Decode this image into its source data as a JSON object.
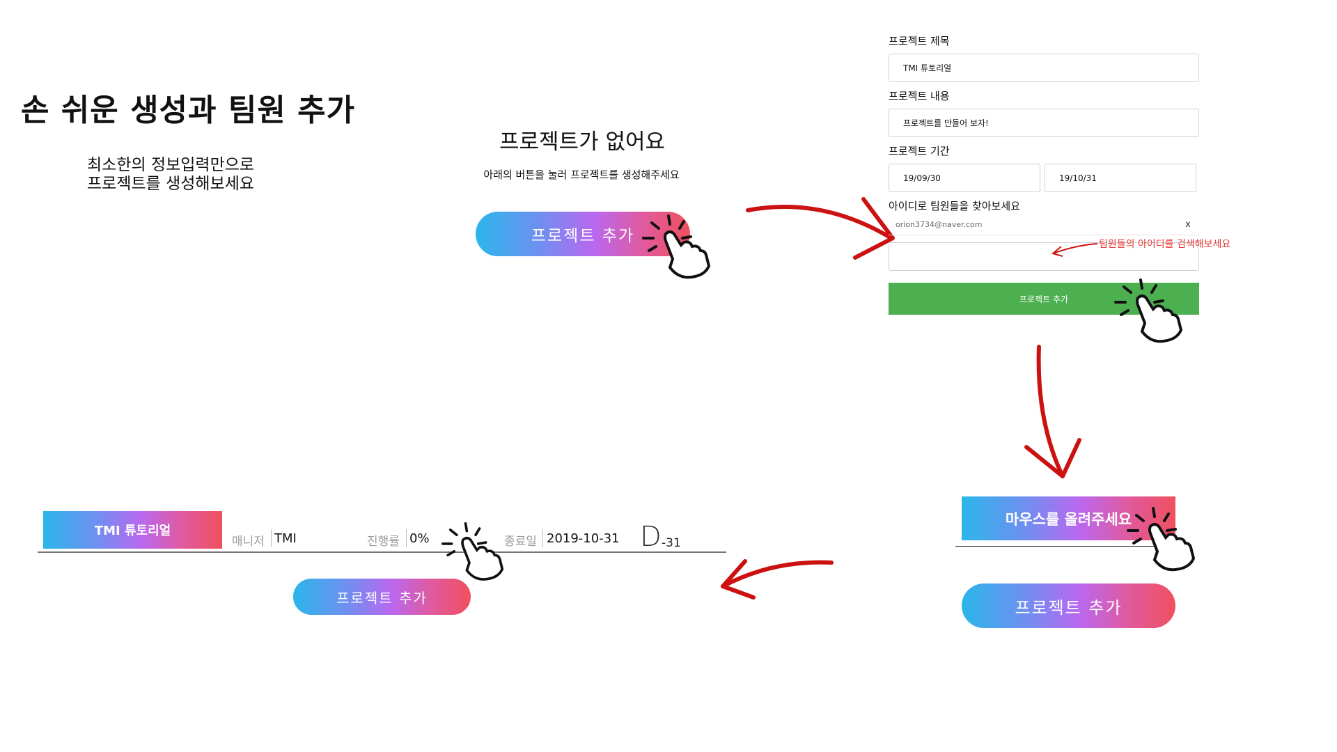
{
  "intro": {
    "title": "손 쉬운 생성과 팀원 추가",
    "subtitle_lines": [
      "최소한의 정보입력만으로",
      "프로젝트를 생성해보세요"
    ]
  },
  "empty_state": {
    "title": "프로젝트가 없어요",
    "description": "아래의 버튼을 눌러 프로젝트를 생성해주세요",
    "add_button_label": "프로젝트 추가"
  },
  "form": {
    "title_label": "프로젝트 제목",
    "title_value": "TMI 튜토리얼",
    "content_label": "프로젝트 내용",
    "content_value": "프로젝트를 만들어 보자!",
    "period_label": "프로젝트 기간",
    "start_date": "19/09/30",
    "end_date": "19/10/31",
    "members_label": "아이디로 팀원들을 찾아보세요",
    "member_email": "orion3734@naver.com",
    "member_remove": "x",
    "search_value": "",
    "search_hint": "팀원들의 아이디를 검색해보세요",
    "submit_label": "프로젝트 추가"
  },
  "hover_demo": {
    "card_label": "마우스를 올려주세요",
    "add_button_label": "프로젝트 추가"
  },
  "project_card": {
    "name": "TMI 튜토리얼",
    "manager_label": "매니저",
    "manager_value": "TMI",
    "progress_label": "진행률",
    "progress_value": "0%",
    "end_label": "종료일",
    "end_value": "2019-10-31",
    "dday_letter": "D",
    "dday_value": "-31",
    "add_button_label": "프로젝트 추가"
  },
  "colors": {
    "gradient": [
      "#2bb6ea",
      "#b968f0",
      "#f0505e"
    ],
    "submit_green": "#4caf50",
    "arrow_red": "#cc1111",
    "hint_red": "#e53935"
  },
  "icons": [
    "click-hand-icon",
    "curved-arrow-icon"
  ]
}
